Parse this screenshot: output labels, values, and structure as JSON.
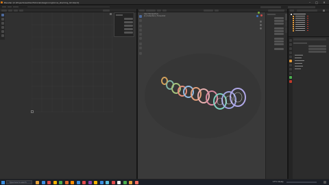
{
  "window": {
    "title": "Blender [C:\\Projects\\Ladder\\Tutorials\\beginning\\torus_stacking_02.blend]",
    "minimize": "–",
    "maximize": "□",
    "close": "✕"
  },
  "taskbar": {
    "search_placeholder": "Type here to search",
    "tray_text": "17°C Cloudy",
    "icon_colors": [
      "#e6a23c",
      "#3b8ee0",
      "#e04b4b",
      "#f4b400",
      "#4caf50",
      "#e06b2d",
      "#ff8c00",
      "#3b8ee0",
      "#e04b4b",
      "#8e44ad",
      "#f4b400",
      "#3b8ee0",
      "#5bc0de",
      "#e04b4b",
      "#f0f0f0",
      "#4caf50",
      "#e6a23c",
      "#ff6f61"
    ]
  },
  "viewport": {
    "info_line1": "User Perspective",
    "info_line2": "(1) Collection | Torus.014"
  },
  "colors": {
    "accent": "#4d6a9c",
    "selected_orange": "#e59b3a"
  }
}
